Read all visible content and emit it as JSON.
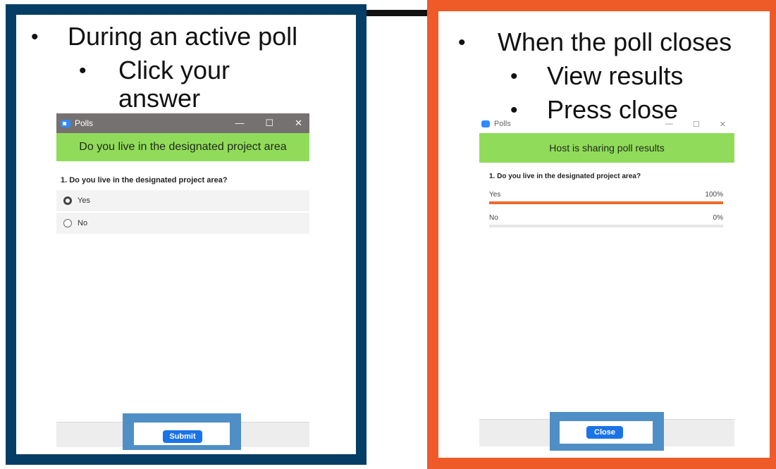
{
  "left": {
    "bullet_main": "During an active poll",
    "bullet_sub": "Click your answer",
    "window": {
      "title": "Polls",
      "min_glyph": "—",
      "max_glyph": "☐",
      "close_glyph": "✕",
      "banner": "Do you live in the designated project area",
      "question": "1. Do you live in the designated project area?",
      "options": [
        {
          "label": "Yes",
          "checked": true
        },
        {
          "label": "No",
          "checked": false
        }
      ],
      "submit_label": "Submit"
    }
  },
  "right": {
    "bullet_main": "When the poll closes",
    "bullet_sub1": "View results",
    "bullet_sub2": "Press close",
    "window": {
      "title": "Polls",
      "min_glyph": "—",
      "max_glyph": "☐",
      "close_glyph": "✕",
      "banner": "Host is sharing poll results",
      "question": "1. Do you live in the designated project area?",
      "results": [
        {
          "label": "Yes",
          "percent_text": "100%",
          "fraction": 1.0
        },
        {
          "label": "No",
          "percent_text": "0%",
          "fraction": 0.0
        }
      ],
      "close_label": "Close"
    }
  },
  "colors": {
    "left_border": "#053e64",
    "right_border": "#ee5b29",
    "banner_green": "#91db5a",
    "button_blue": "#1a73e8",
    "result_bar": "#ee6a2b",
    "highlight_blue": "#4f8fc6"
  }
}
